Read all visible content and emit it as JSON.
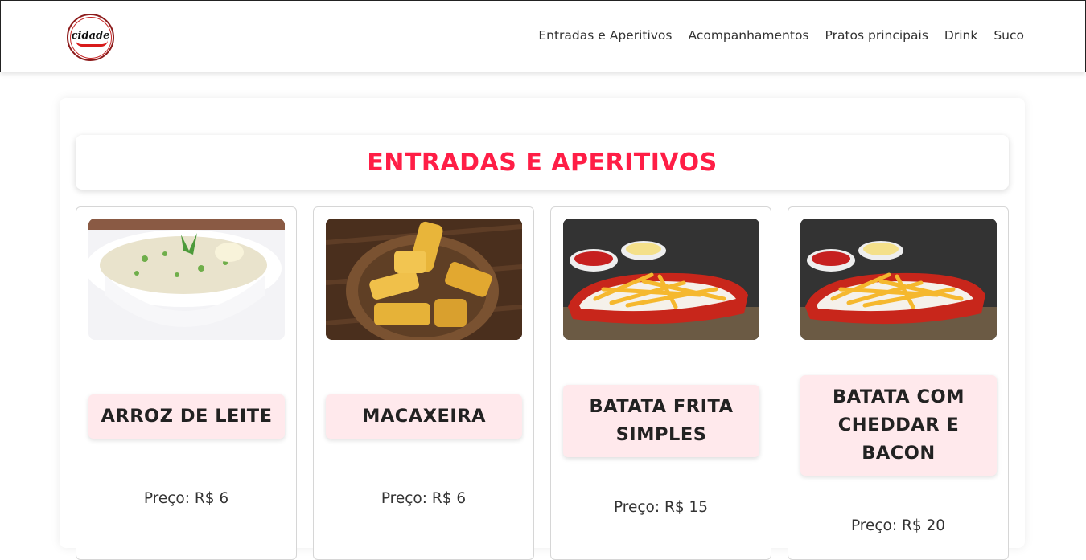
{
  "nav": {
    "logo_text": "cidade",
    "links": [
      "Entradas e Aperitivos",
      "Acompanhamentos",
      "Pratos principais",
      "Drink",
      "Suco"
    ]
  },
  "section": {
    "title": "ENTRADAS E APERITIVOS"
  },
  "items": [
    {
      "name": "ARROZ DE LEITE",
      "price": "Preço: R$ 6",
      "image": "rice-dish-image"
    },
    {
      "name": "MACAXEIRA",
      "price": "Preço: R$ 6",
      "image": "fried-cassava-image"
    },
    {
      "name": "BATATA FRITA SIMPLES",
      "price": "Preço: R$ 15",
      "image": "french-fries-image"
    },
    {
      "name": "BATATA COM CHEDDAR E BACON",
      "price": "Preço: R$ 20",
      "image": "french-fries-image"
    }
  ],
  "colors": {
    "accent": "#ff1e46",
    "name_bg": "#ffe9ec",
    "logo_red": "#d81b1b"
  }
}
